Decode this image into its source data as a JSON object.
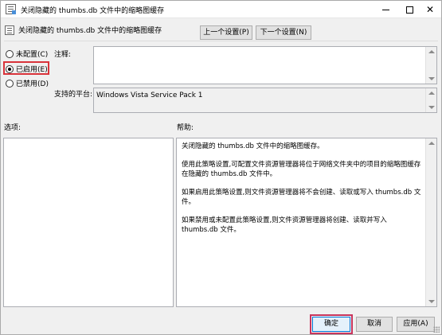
{
  "window": {
    "title": "关闭隐藏的 thumbs.db 文件中的缩略图缓存",
    "minimize_glyph": "—",
    "close_glyph": "✕"
  },
  "header": {
    "policy_name": "关闭隐藏的 thumbs.db 文件中的缩略图缓存",
    "prev_button": "上一个设置(P)",
    "next_button": "下一个设置(N)"
  },
  "state": {
    "options": [
      {
        "label": "未配置(C)",
        "checked": false
      },
      {
        "label": "已启用(E)",
        "checked": true
      },
      {
        "label": "已禁用(D)",
        "checked": false
      }
    ]
  },
  "comment": {
    "label": "注释:",
    "value": ""
  },
  "platform": {
    "label": "支持的平台:",
    "value": "Windows Vista Service Pack 1"
  },
  "options_panel": {
    "label": "选项:"
  },
  "help_panel": {
    "label": "帮助:",
    "paragraphs": [
      "关闭隐藏的 thumbs.db 文件中的缩略图缓存。",
      "使用此策略设置,可配置文件资源管理器将位于网络文件夹中的项目的缩略图缓存在隐藏的 thumbs.db 文件中。",
      "如果启用此策略设置,则文件资源管理器将不会创建、读取或写入 thumbs.db 文件。",
      "如果禁用或未配置此策略设置,则文件资源管理器将创建、读取并写入 thumbs.db 文件。"
    ]
  },
  "footer": {
    "ok": "确定",
    "cancel": "取消",
    "apply": "应用(A)"
  },
  "colors": {
    "highlight_red": "#d9333a",
    "ok_border": "#0078d7"
  }
}
